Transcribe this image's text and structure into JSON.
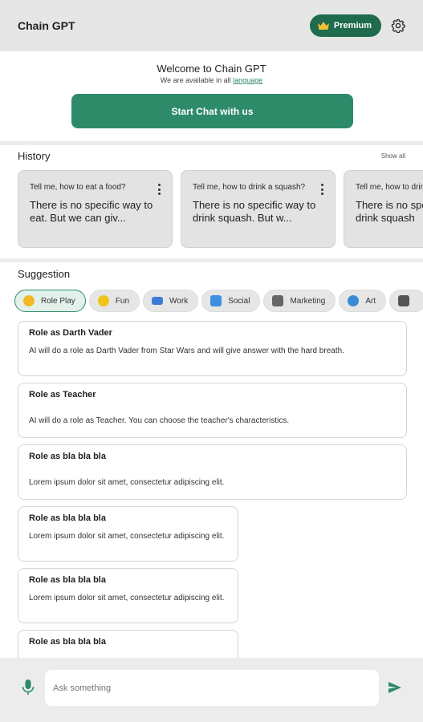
{
  "header": {
    "title": "Chain GPT",
    "premium_label": "Premium"
  },
  "welcome": {
    "title": "Welcome to Chain GPT",
    "subtitle": "We are available in all",
    "language_link": "language",
    "start_button": "Start Chat with us"
  },
  "history": {
    "title": "History",
    "show_all": "Show all",
    "cards": [
      {
        "question": "Tell me, how to eat a food?",
        "answer": "There is no specific way to eat. But we can giv..."
      },
      {
        "question": "Tell me, how to drink a squash?",
        "answer": "There is no specific way to drink squash. But w..."
      },
      {
        "question": "Tell me, how to drink a squash?",
        "answer": "There is no specific way to drink squash"
      }
    ]
  },
  "suggestion": {
    "title": "Suggestion",
    "chips": [
      {
        "label": "Role Play",
        "icon": "face-icon",
        "color": "#f2b824"
      },
      {
        "label": "Fun",
        "icon": "laugh-icon",
        "color": "#f0c419"
      },
      {
        "label": "Work",
        "icon": "laptop-icon",
        "color": "#3b7bd6"
      },
      {
        "label": "Social",
        "icon": "chat-icon",
        "color": "#3d8fe0"
      },
      {
        "label": "Marketing",
        "icon": "store-icon",
        "color": "#666666"
      },
      {
        "label": "Art",
        "icon": "palette-icon",
        "color": "#3a8ad6"
      },
      {
        "label": "",
        "icon": "grad-cap-icon",
        "color": "#555555"
      }
    ],
    "items": [
      {
        "title": "Role as Darth Vader",
        "desc": "AI will do a role as Darth Vader from Star Wars and will give answer with the hard breath."
      },
      {
        "title": "Role as Teacher",
        "desc": "AI will do a role as Teacher. You can choose the teacher's characteristics."
      },
      {
        "title": "Role as bla bla bla",
        "desc": "Lorem ipsum dolor sit amet, consectetur adipiscing elit."
      },
      {
        "title": "Role as bla bla bla",
        "desc": "Lorem ipsum dolor sit amet, consectetur adipiscing elit."
      },
      {
        "title": "Role as bla bla bla",
        "desc": "Lorem ipsum dolor sit amet, consectetur adipiscing elit."
      },
      {
        "title": "Role as bla bla bla",
        "desc": ""
      }
    ]
  },
  "composer": {
    "placeholder": "Ask something"
  },
  "colors": {
    "accent": "#2e8b6a",
    "premium_bg": "#1e6b4e",
    "crown": "#f2c12e"
  }
}
